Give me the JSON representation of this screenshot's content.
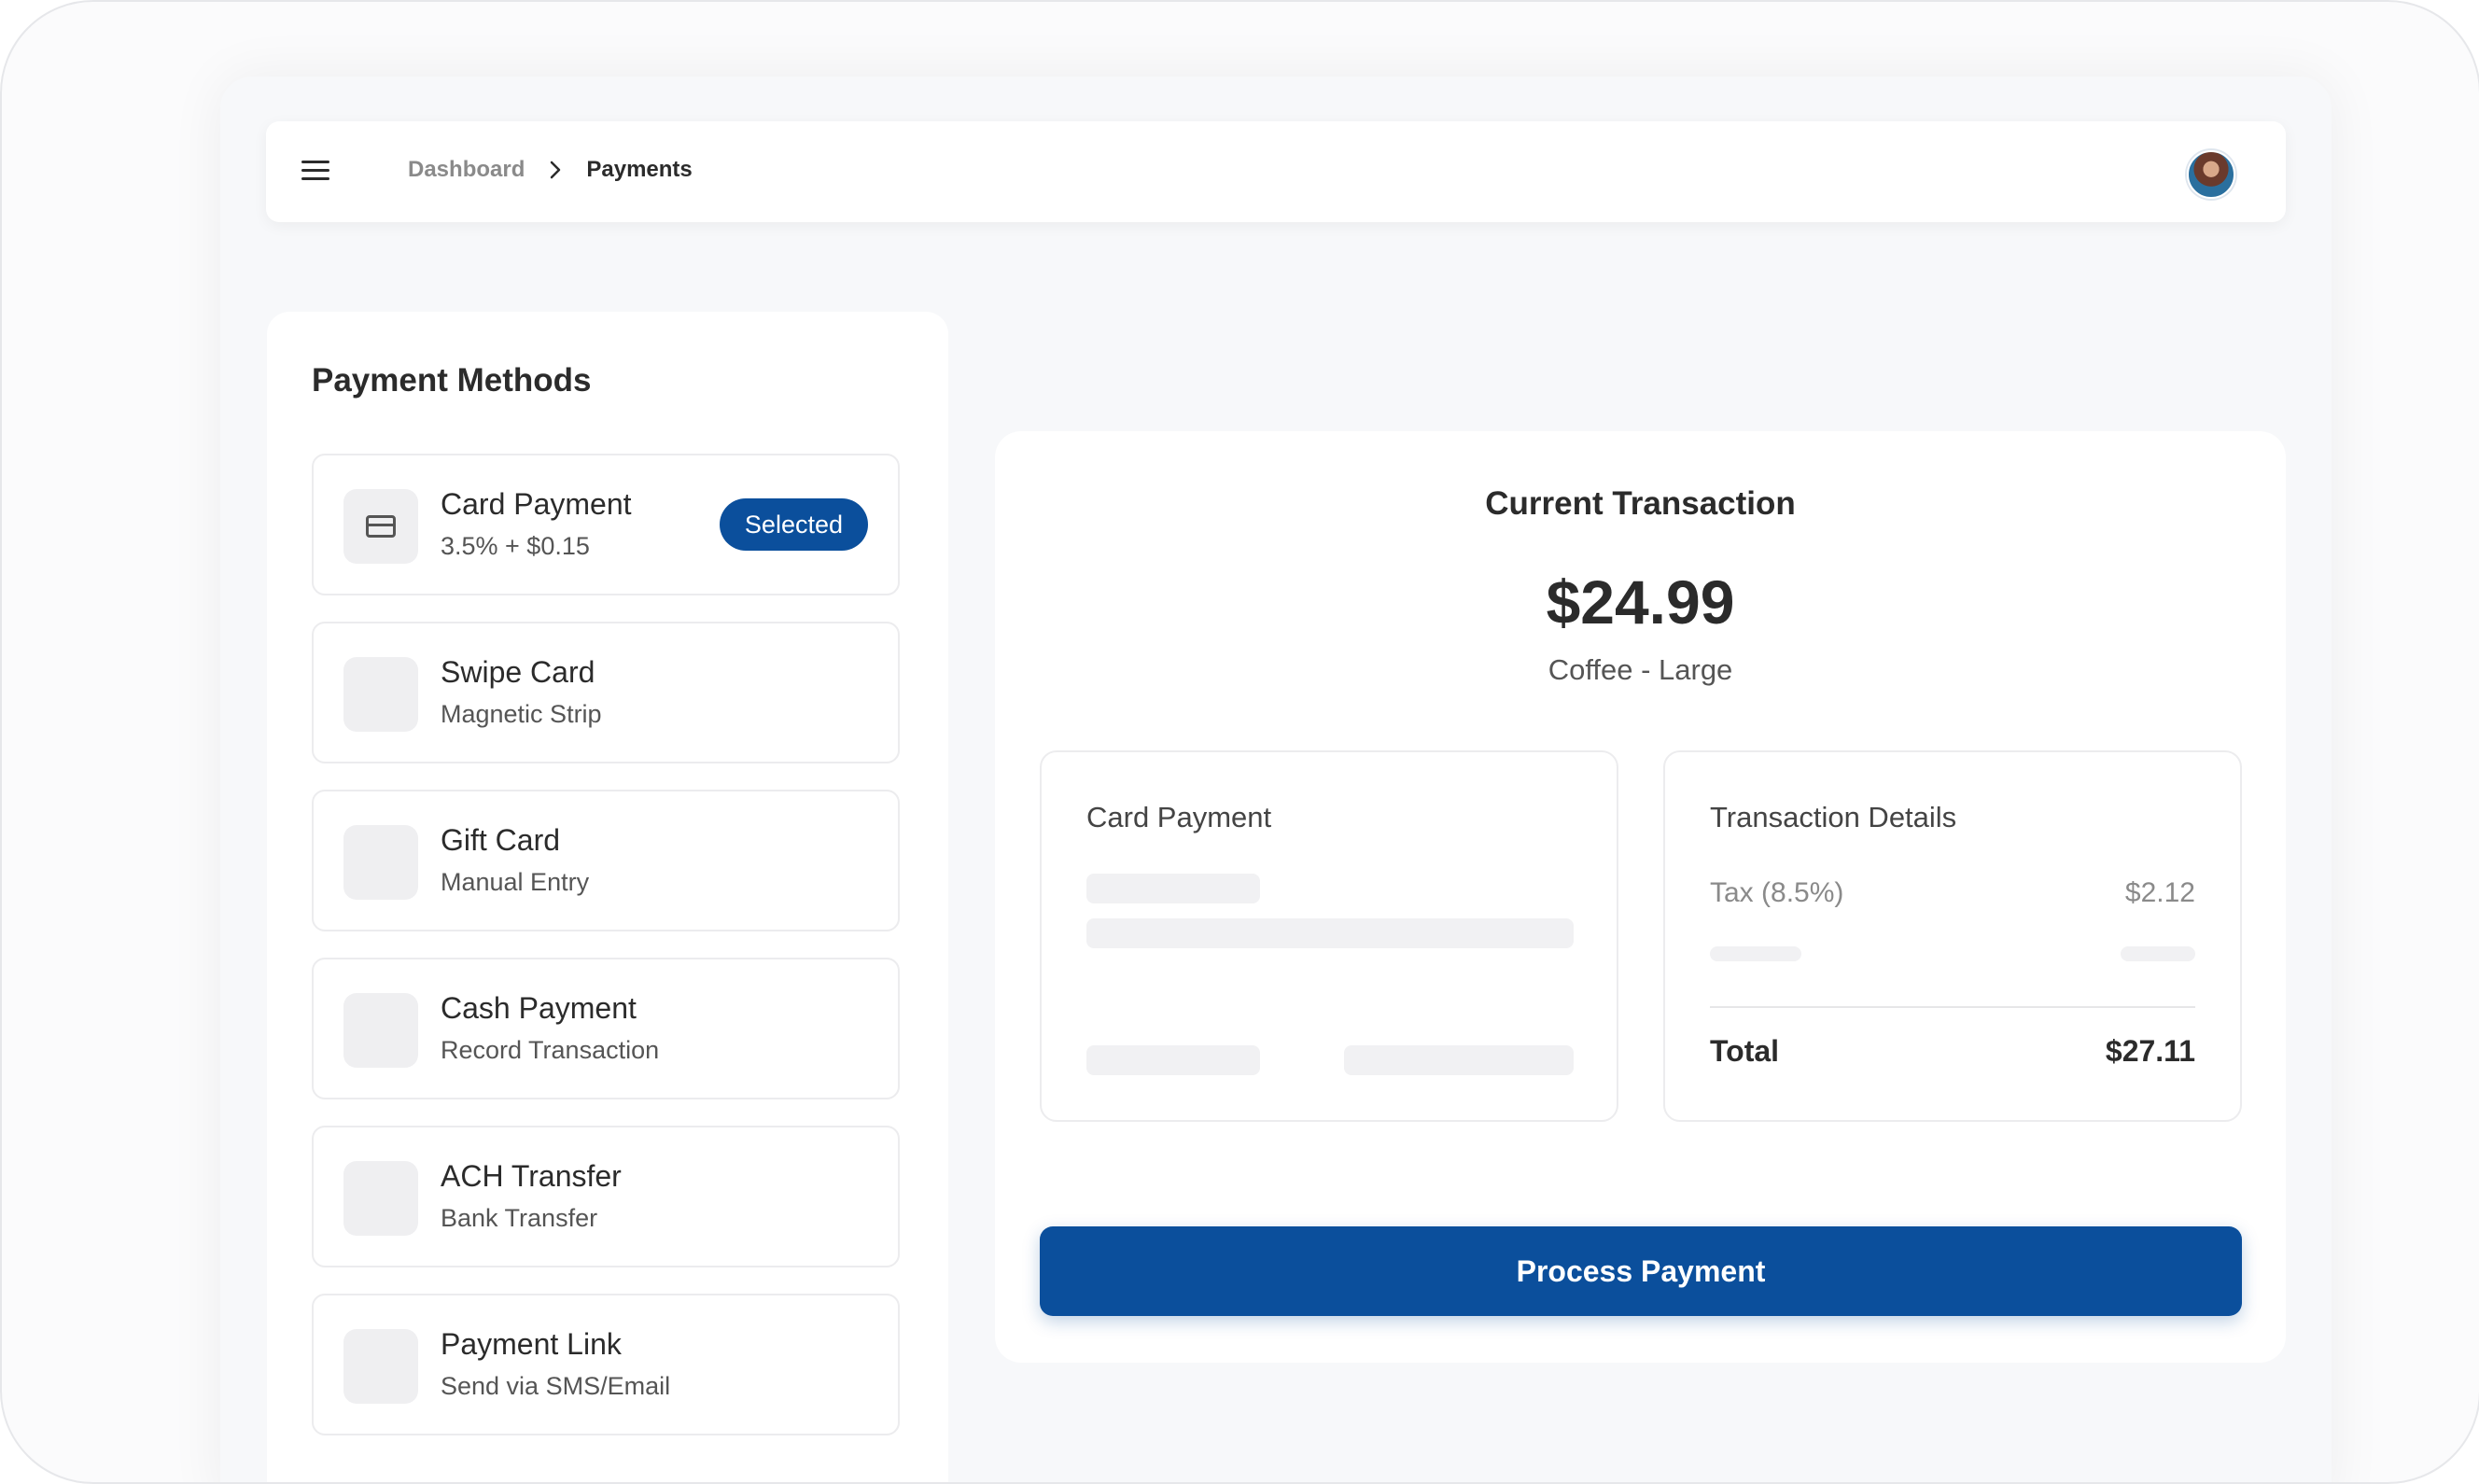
{
  "breadcrumb": {
    "parent": "Dashboard",
    "current": "Payments"
  },
  "payment_methods": {
    "title": "Payment Methods",
    "selected_badge": "Selected",
    "items": [
      {
        "name": "Card Payment",
        "sub": "3.5% + $0.15",
        "icon": "credit-card-icon",
        "selected": true
      },
      {
        "name": "Swipe Card",
        "sub": "Magnetic Strip",
        "icon": "placeholder-icon",
        "selected": false
      },
      {
        "name": "Gift Card",
        "sub": "Manual Entry",
        "icon": "placeholder-icon",
        "selected": false
      },
      {
        "name": "Cash Payment",
        "sub": "Record Transaction",
        "icon": "placeholder-icon",
        "selected": false
      },
      {
        "name": "ACH Transfer",
        "sub": "Bank Transfer",
        "icon": "placeholder-icon",
        "selected": false
      },
      {
        "name": "Payment Link",
        "sub": "Send via SMS/Email",
        "icon": "placeholder-icon",
        "selected": false
      }
    ]
  },
  "transaction": {
    "title": "Current Transaction",
    "amount": "$24.99",
    "item": "Coffee - Large",
    "card_section_title": "Card Payment",
    "details": {
      "title": "Transaction Details",
      "tax_label": "Tax (8.5%)",
      "tax_value": "$2.12",
      "total_label": "Total",
      "total_value": "$27.11"
    },
    "process_button": "Process Payment"
  },
  "colors": {
    "accent": "#0b4f9c",
    "background": "#f7f8fa",
    "card": "#ffffff"
  }
}
